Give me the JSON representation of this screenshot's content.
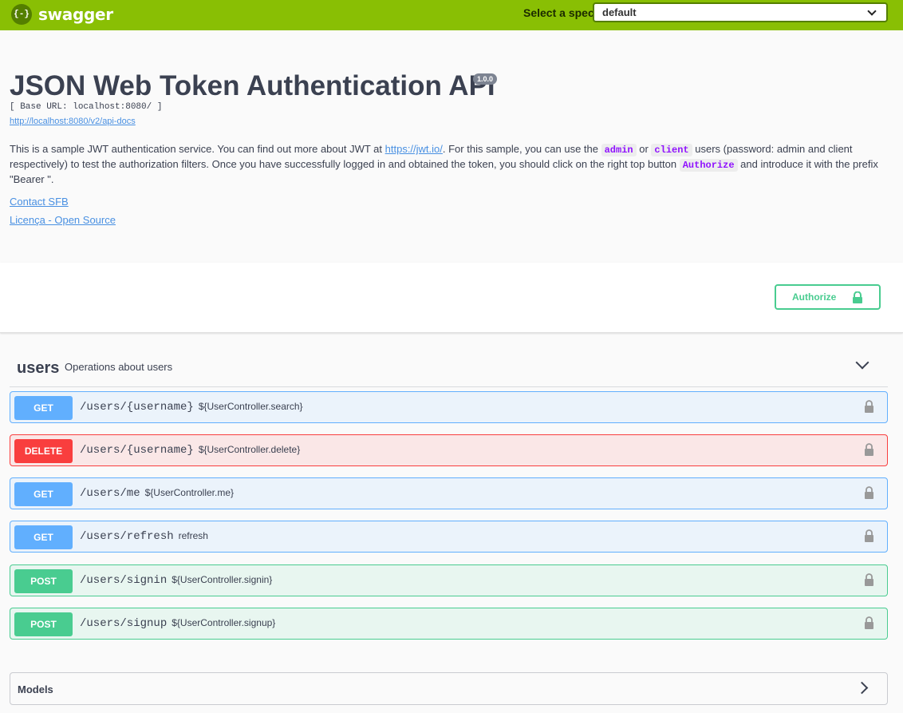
{
  "topbar": {
    "logo_mark": "{-}",
    "logo_text": "swagger",
    "spec_label": "Select a spec",
    "spec_value": "default",
    "bg_color": "#89bf04"
  },
  "info": {
    "title": "JSON Web Token Authentication API",
    "version": "1.0.0",
    "base_url": "[ Base URL: localhost:8080/ ]",
    "api_docs_link": "http://localhost:8080/v2/api-docs",
    "desc_1": "This is a sample JWT authentication service. You can find out more about JWT at ",
    "desc_link": "https://jwt.io/",
    "desc_2": ". For this sample, you can use the ",
    "desc_code_admin": "admin",
    "desc_3": " or ",
    "desc_code_client": "client",
    "desc_4": " users (password: admin and client respectively) to test the authorization filters. Once you have successfully logged in and obtained the token, you should click on the right top button ",
    "desc_code_authorize": "Authorize",
    "desc_5": " and introduce it with the prefix \"Bearer \".",
    "contact": "Contact SFB",
    "license": "Licença - Open Source"
  },
  "auth": {
    "button_label": "Authorize",
    "icon": "lock-icon"
  },
  "tag": {
    "name": "users",
    "description": "Operations about users"
  },
  "operations": [
    {
      "method": "GET",
      "path": "/users/{username}",
      "summary": "${UserController.search}"
    },
    {
      "method": "DELETE",
      "path": "/users/{username}",
      "summary": "${UserController.delete}"
    },
    {
      "method": "GET",
      "path": "/users/me",
      "summary": "${UserController.me}"
    },
    {
      "method": "GET",
      "path": "/users/refresh",
      "summary": "refresh"
    },
    {
      "method": "POST",
      "path": "/users/signin",
      "summary": "${UserController.signin}"
    },
    {
      "method": "POST",
      "path": "/users/signup",
      "summary": "${UserController.signup}"
    }
  ],
  "models": {
    "title": "Models"
  },
  "colors": {
    "get": "#61affe",
    "delete": "#f93e3e",
    "post": "#49cc90",
    "link": "#4990e2"
  }
}
